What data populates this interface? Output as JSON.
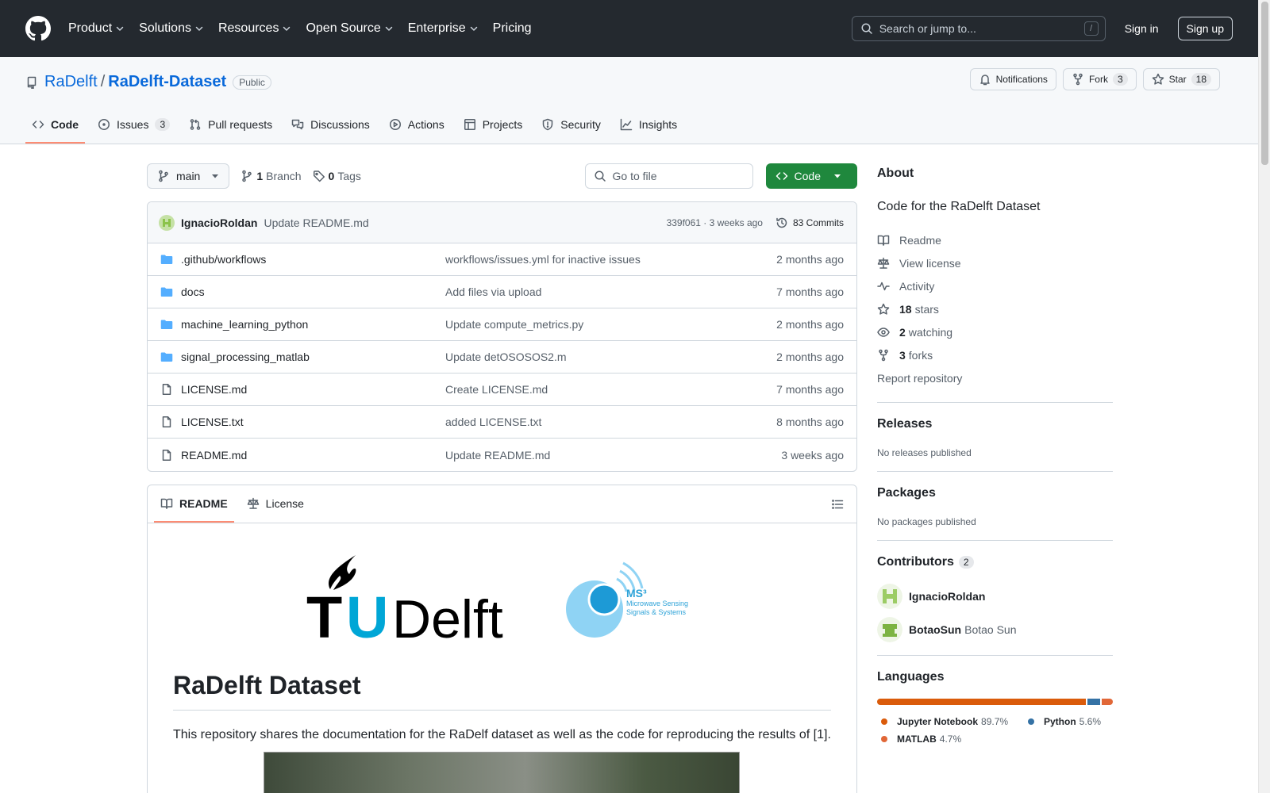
{
  "nav": {
    "items": [
      "Product",
      "Solutions",
      "Resources",
      "Open Source",
      "Enterprise"
    ],
    "pricing": "Pricing",
    "search_placeholder": "Search or jump to...",
    "search_key": "/",
    "sign_in": "Sign in",
    "sign_up": "Sign up"
  },
  "repo": {
    "owner": "RaDelft",
    "sep": "/",
    "name": "RaDelft-Dataset",
    "visibility": "Public",
    "notifications": "Notifications",
    "fork_label": "Fork",
    "fork_count": "3",
    "star_label": "Star",
    "star_count": "18"
  },
  "tabs": [
    {
      "label": "Code",
      "count": null
    },
    {
      "label": "Issues",
      "count": "3"
    },
    {
      "label": "Pull requests",
      "count": null
    },
    {
      "label": "Discussions",
      "count": null
    },
    {
      "label": "Actions",
      "count": null
    },
    {
      "label": "Projects",
      "count": null
    },
    {
      "label": "Security",
      "count": null
    },
    {
      "label": "Insights",
      "count": null
    }
  ],
  "branchbar": {
    "branch": "main",
    "branch_count": "1",
    "branch_label": "Branch",
    "tag_count": "0",
    "tag_label": "Tags",
    "goto_placeholder": "Go to file",
    "code_button": "Code"
  },
  "commit": {
    "author": "IgnacioRoldan",
    "message": "Update README.md",
    "hash_time": "339f061 · 3 weeks ago",
    "count": "83 Commits"
  },
  "files": [
    {
      "name": ".github/workflows",
      "type": "dir",
      "message": "workflows/issues.yml for inactive issues",
      "date": "2 months ago"
    },
    {
      "name": "docs",
      "type": "dir",
      "message": "Add files via upload",
      "date": "7 months ago"
    },
    {
      "name": "machine_learning_python",
      "type": "dir",
      "message": "Update compute_metrics.py",
      "date": "2 months ago"
    },
    {
      "name": "signal_processing_matlab",
      "type": "dir",
      "message": "Update detOSOSOS2.m",
      "date": "2 months ago"
    },
    {
      "name": "LICENSE.md",
      "type": "file",
      "message": "Create LICENSE.md",
      "date": "7 months ago"
    },
    {
      "name": "LICENSE.txt",
      "type": "file",
      "message": "added LICENSE.txt",
      "date": "8 months ago"
    },
    {
      "name": "README.md",
      "type": "file",
      "message": "Update README.md",
      "date": "3 weeks ago"
    }
  ],
  "readme": {
    "tab_readme": "README",
    "tab_license": "License",
    "logo_tud_t": "T",
    "logo_tud_u": "U",
    "logo_tud_delft": "Delft",
    "logo_ms3": "MS³",
    "logo_ms3_line1": "Microwave Sensing",
    "logo_ms3_line2": "Signals & Systems",
    "heading": "RaDelft Dataset",
    "intro": "This repository shares the documentation for the RaDelf dataset as well as the code for reproducing the results of [1]."
  },
  "about": {
    "title": "About",
    "description": "Code for the RaDelft Dataset",
    "readme": "Readme",
    "license": "View license",
    "activity": "Activity",
    "stars_count": "18",
    "stars_label": "stars",
    "watching_count": "2",
    "watching_label": "watching",
    "forks_count": "3",
    "forks_label": "forks",
    "report": "Report repository"
  },
  "releases": {
    "title": "Releases",
    "empty": "No releases published"
  },
  "packages": {
    "title": "Packages",
    "empty": "No packages published"
  },
  "contributors": {
    "title": "Contributors",
    "count": "2",
    "list": [
      {
        "login": "IgnacioRoldan",
        "fullname": ""
      },
      {
        "login": "BotaoSun",
        "fullname": "Botao Sun"
      }
    ]
  },
  "languages": {
    "title": "Languages",
    "list": [
      {
        "name": "Jupyter Notebook",
        "percent": "89.7%",
        "value": 89.7,
        "color": "#DA5B0B"
      },
      {
        "name": "Python",
        "percent": "5.6%",
        "value": 5.6,
        "color": "#3572A5"
      },
      {
        "name": "MATLAB",
        "percent": "4.7%",
        "value": 4.7,
        "color": "#e16737"
      }
    ]
  }
}
